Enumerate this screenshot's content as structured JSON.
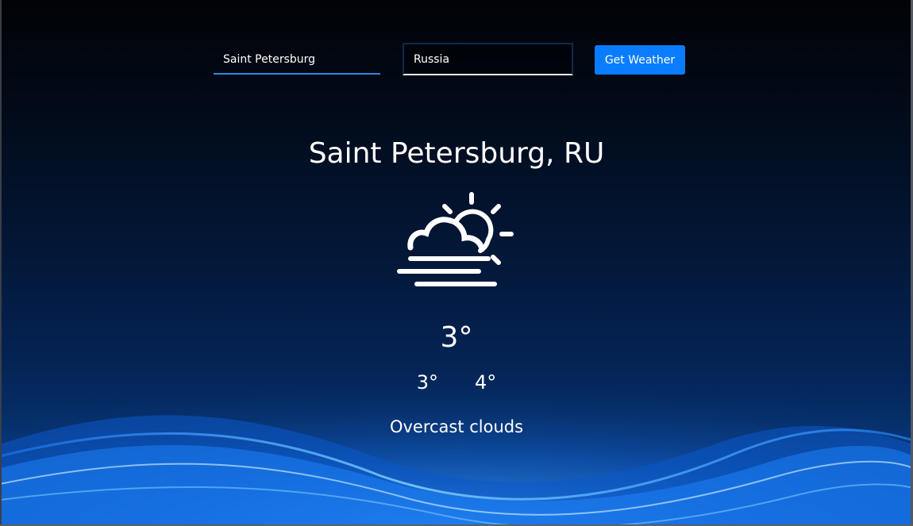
{
  "search": {
    "city_value": "Saint Petersburg",
    "country_value": "Russia",
    "submit_label": "Get Weather"
  },
  "weather": {
    "location": "Saint Petersburg, RU",
    "icon": "partly-cloudy-fog-icon",
    "temperature": "3°",
    "temp_min": "3°",
    "temp_max": "4°",
    "description": "Overcast clouds"
  },
  "colors": {
    "accent": "#0a7cff",
    "input_underline": "#2f86e6",
    "text": "#ffffff"
  }
}
